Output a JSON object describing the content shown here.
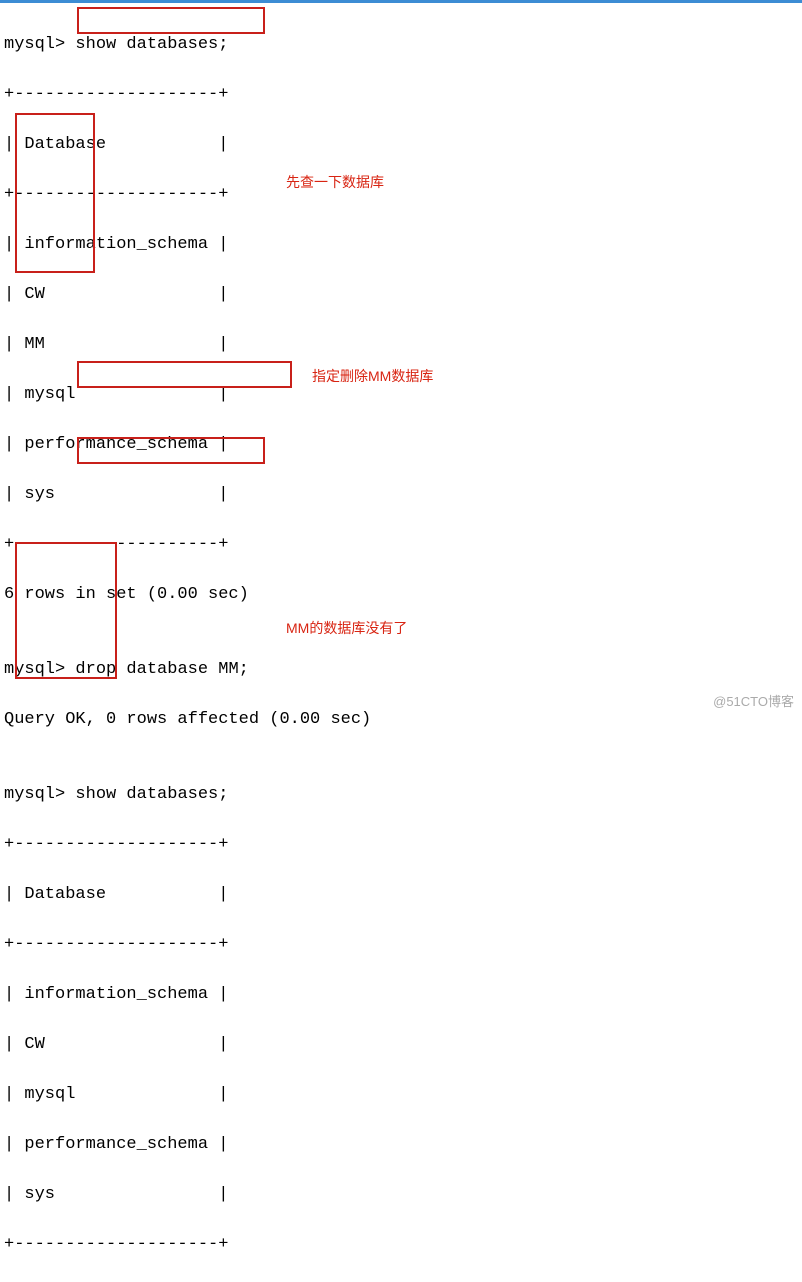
{
  "prompt": "mysql>",
  "commands": {
    "show1": "show databases;",
    "drop": "drop database MM;",
    "show2": "show databases;"
  },
  "border": "+--------------------+",
  "header": "| Database           |",
  "dbs1": {
    "information_schema": "| information_schema |",
    "CW": "| CW                 |",
    "MM": "| MM                 |",
    "mysql": "| mysql              |",
    "performance_schema": "| performance_schema |",
    "sys": "| sys                |"
  },
  "dbs2": {
    "information_schema": "| information_schema |",
    "CW": "| CW                 |",
    "mysql": "| mysql              |",
    "performance_schema": "| performance_schema |",
    "sys": "| sys                |"
  },
  "result1": "6 rows in set (0.00 sec)",
  "result_drop": "Query OK, 0 rows affected (0.00 sec)",
  "blank": "",
  "annotations": {
    "a1": "先查一下数据库",
    "a2": "指定删除MM数据库",
    "a3": "MM的数据库没有了"
  },
  "watermark": "@51CTO博客"
}
